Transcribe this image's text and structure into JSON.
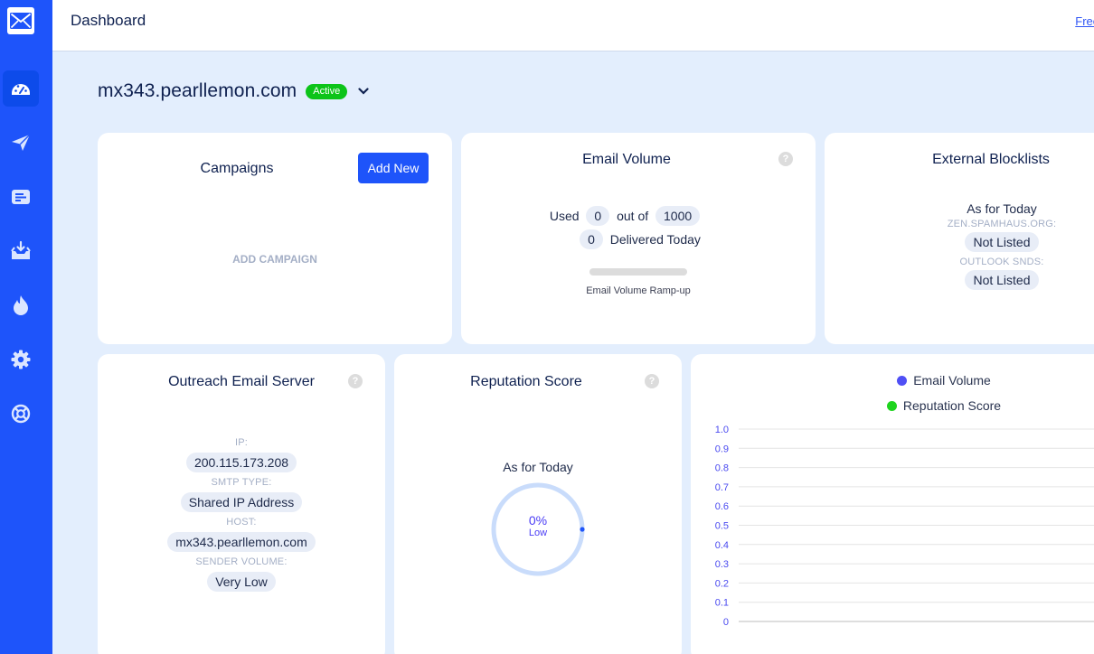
{
  "app": {
    "logo_icon": "envelope-icon",
    "brand_color": "#1e54fa"
  },
  "sidebar": {
    "items": [
      {
        "icon": "dashboard-gauge-icon",
        "label": "Dashboard",
        "active": true
      },
      {
        "icon": "paper-plane-icon",
        "label": "Campaigns",
        "active": false
      },
      {
        "icon": "message-card-icon",
        "label": "Messages",
        "active": false
      },
      {
        "icon": "inbox-download-icon",
        "label": "Inbox",
        "active": false
      },
      {
        "icon": "flame-icon",
        "label": "Warmup",
        "active": false
      },
      {
        "icon": "gear-icon",
        "label": "Settings",
        "active": false
      },
      {
        "icon": "lifebuoy-icon",
        "label": "Support",
        "active": false
      }
    ]
  },
  "header": {
    "title": "Dashboard",
    "right_link": "Free"
  },
  "server": {
    "name": "mx343.pearllemon.com",
    "status": "Active",
    "status_color": "#0cc419"
  },
  "campaigns": {
    "title": "Campaigns",
    "add_button": "Add New",
    "empty_text": "ADD CAMPAIGN"
  },
  "email_volume": {
    "title": "Email Volume",
    "used_label": "Used",
    "used_value": "0",
    "out_of_label": "out of",
    "limit_value": "1000",
    "delivered_value": "0",
    "delivered_label": "Delivered Today",
    "ramp_progress": 0,
    "ramp_label": "Email Volume Ramp-up"
  },
  "blocklists": {
    "title": "External Blocklists",
    "as_for_today": "As for Today",
    "lists": [
      {
        "name": "ZEN.SPAMHAUS.ORG:",
        "status": "Not Listed"
      },
      {
        "name": "OUTLOOK SNDS:",
        "status": "Not Listed"
      }
    ]
  },
  "outreach_server": {
    "title": "Outreach Email Server",
    "fields": [
      {
        "label": "IP:",
        "value": "200.115.173.208"
      },
      {
        "label": "SMTP TYPE:",
        "value": "Shared IP Address"
      },
      {
        "label": "HOST:",
        "value": "mx343.pearllemon.com"
      },
      {
        "label": "SENDER VOLUME:",
        "value": "Very Low"
      }
    ]
  },
  "reputation": {
    "title": "Reputation Score",
    "as_for_today": "As for Today",
    "percent_text": "0%",
    "percent_value": 0,
    "level": "Low"
  },
  "chart_data": {
    "type": "line",
    "title": "",
    "xlabel": "",
    "ylabel": "",
    "legend_position": "top-center",
    "series": [
      {
        "name": "Email Volume",
        "color": "#4f4ff5",
        "values": []
      },
      {
        "name": "Reputation Score",
        "color": "#1ed41e",
        "values": []
      }
    ],
    "categories": [],
    "ylim": [
      0,
      1.0
    ],
    "y_ticks": [
      "0",
      "0.1",
      "0.2",
      "0.3",
      "0.4",
      "0.5",
      "0.6",
      "0.7",
      "0.8",
      "0.9",
      "1.0"
    ],
    "grid": true
  }
}
